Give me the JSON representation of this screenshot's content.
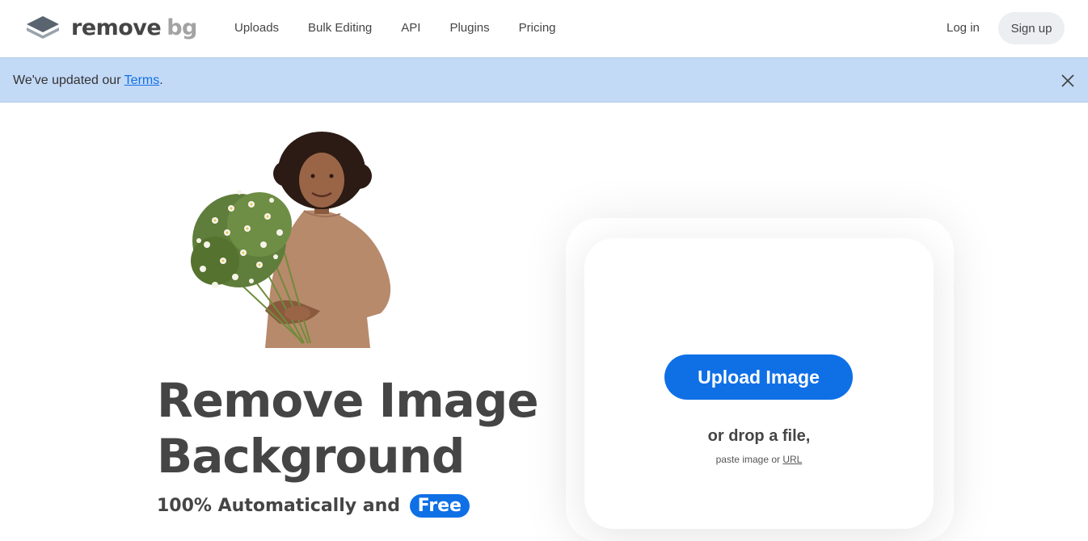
{
  "brand": {
    "name_main": "remove",
    "name_suffix": "bg"
  },
  "nav": {
    "items": [
      {
        "label": "Uploads"
      },
      {
        "label": "Bulk Editing"
      },
      {
        "label": "API"
      },
      {
        "label": "Plugins"
      },
      {
        "label": "Pricing"
      }
    ],
    "login_label": "Log in",
    "signup_label": "Sign up"
  },
  "banner": {
    "text_before": "We've updated our ",
    "link_text": "Terms",
    "text_after": "."
  },
  "hero": {
    "headline_line1": "Remove Image",
    "headline_line2": "Background",
    "subline_text": "100% Automatically and ",
    "free_badge": "Free"
  },
  "upload": {
    "button_label": "Upload Image",
    "drop_text": "or drop a file,",
    "paste_text": "paste image or ",
    "url_link": "URL"
  },
  "colors": {
    "accent": "#0f70e6",
    "banner_bg": "#c3daf7",
    "text": "#454545"
  }
}
